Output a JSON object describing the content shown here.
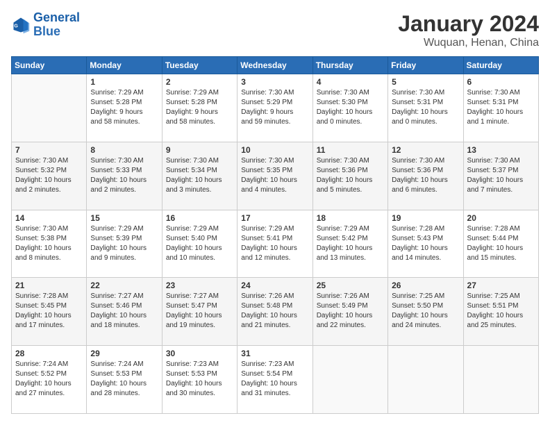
{
  "logo": {
    "line1": "General",
    "line2": "Blue"
  },
  "title": "January 2024",
  "subtitle": "Wuquan, Henan, China",
  "days_header": [
    "Sunday",
    "Monday",
    "Tuesday",
    "Wednesday",
    "Thursday",
    "Friday",
    "Saturday"
  ],
  "weeks": [
    [
      {
        "num": "",
        "info": ""
      },
      {
        "num": "1",
        "info": "Sunrise: 7:29 AM\nSunset: 5:28 PM\nDaylight: 9 hours\nand 58 minutes."
      },
      {
        "num": "2",
        "info": "Sunrise: 7:29 AM\nSunset: 5:28 PM\nDaylight: 9 hours\nand 58 minutes."
      },
      {
        "num": "3",
        "info": "Sunrise: 7:30 AM\nSunset: 5:29 PM\nDaylight: 9 hours\nand 59 minutes."
      },
      {
        "num": "4",
        "info": "Sunrise: 7:30 AM\nSunset: 5:30 PM\nDaylight: 10 hours\nand 0 minutes."
      },
      {
        "num": "5",
        "info": "Sunrise: 7:30 AM\nSunset: 5:31 PM\nDaylight: 10 hours\nand 0 minutes."
      },
      {
        "num": "6",
        "info": "Sunrise: 7:30 AM\nSunset: 5:31 PM\nDaylight: 10 hours\nand 1 minute."
      }
    ],
    [
      {
        "num": "7",
        "info": "Sunrise: 7:30 AM\nSunset: 5:32 PM\nDaylight: 10 hours\nand 2 minutes."
      },
      {
        "num": "8",
        "info": "Sunrise: 7:30 AM\nSunset: 5:33 PM\nDaylight: 10 hours\nand 2 minutes."
      },
      {
        "num": "9",
        "info": "Sunrise: 7:30 AM\nSunset: 5:34 PM\nDaylight: 10 hours\nand 3 minutes."
      },
      {
        "num": "10",
        "info": "Sunrise: 7:30 AM\nSunset: 5:35 PM\nDaylight: 10 hours\nand 4 minutes."
      },
      {
        "num": "11",
        "info": "Sunrise: 7:30 AM\nSunset: 5:36 PM\nDaylight: 10 hours\nand 5 minutes."
      },
      {
        "num": "12",
        "info": "Sunrise: 7:30 AM\nSunset: 5:36 PM\nDaylight: 10 hours\nand 6 minutes."
      },
      {
        "num": "13",
        "info": "Sunrise: 7:30 AM\nSunset: 5:37 PM\nDaylight: 10 hours\nand 7 minutes."
      }
    ],
    [
      {
        "num": "14",
        "info": "Sunrise: 7:30 AM\nSunset: 5:38 PM\nDaylight: 10 hours\nand 8 minutes."
      },
      {
        "num": "15",
        "info": "Sunrise: 7:29 AM\nSunset: 5:39 PM\nDaylight: 10 hours\nand 9 minutes."
      },
      {
        "num": "16",
        "info": "Sunrise: 7:29 AM\nSunset: 5:40 PM\nDaylight: 10 hours\nand 10 minutes."
      },
      {
        "num": "17",
        "info": "Sunrise: 7:29 AM\nSunset: 5:41 PM\nDaylight: 10 hours\nand 12 minutes."
      },
      {
        "num": "18",
        "info": "Sunrise: 7:29 AM\nSunset: 5:42 PM\nDaylight: 10 hours\nand 13 minutes."
      },
      {
        "num": "19",
        "info": "Sunrise: 7:28 AM\nSunset: 5:43 PM\nDaylight: 10 hours\nand 14 minutes."
      },
      {
        "num": "20",
        "info": "Sunrise: 7:28 AM\nSunset: 5:44 PM\nDaylight: 10 hours\nand 15 minutes."
      }
    ],
    [
      {
        "num": "21",
        "info": "Sunrise: 7:28 AM\nSunset: 5:45 PM\nDaylight: 10 hours\nand 17 minutes."
      },
      {
        "num": "22",
        "info": "Sunrise: 7:27 AM\nSunset: 5:46 PM\nDaylight: 10 hours\nand 18 minutes."
      },
      {
        "num": "23",
        "info": "Sunrise: 7:27 AM\nSunset: 5:47 PM\nDaylight: 10 hours\nand 19 minutes."
      },
      {
        "num": "24",
        "info": "Sunrise: 7:26 AM\nSunset: 5:48 PM\nDaylight: 10 hours\nand 21 minutes."
      },
      {
        "num": "25",
        "info": "Sunrise: 7:26 AM\nSunset: 5:49 PM\nDaylight: 10 hours\nand 22 minutes."
      },
      {
        "num": "26",
        "info": "Sunrise: 7:25 AM\nSunset: 5:50 PM\nDaylight: 10 hours\nand 24 minutes."
      },
      {
        "num": "27",
        "info": "Sunrise: 7:25 AM\nSunset: 5:51 PM\nDaylight: 10 hours\nand 25 minutes."
      }
    ],
    [
      {
        "num": "28",
        "info": "Sunrise: 7:24 AM\nSunset: 5:52 PM\nDaylight: 10 hours\nand 27 minutes."
      },
      {
        "num": "29",
        "info": "Sunrise: 7:24 AM\nSunset: 5:53 PM\nDaylight: 10 hours\nand 28 minutes."
      },
      {
        "num": "30",
        "info": "Sunrise: 7:23 AM\nSunset: 5:53 PM\nDaylight: 10 hours\nand 30 minutes."
      },
      {
        "num": "31",
        "info": "Sunrise: 7:23 AM\nSunset: 5:54 PM\nDaylight: 10 hours\nand 31 minutes."
      },
      {
        "num": "",
        "info": ""
      },
      {
        "num": "",
        "info": ""
      },
      {
        "num": "",
        "info": ""
      }
    ]
  ]
}
